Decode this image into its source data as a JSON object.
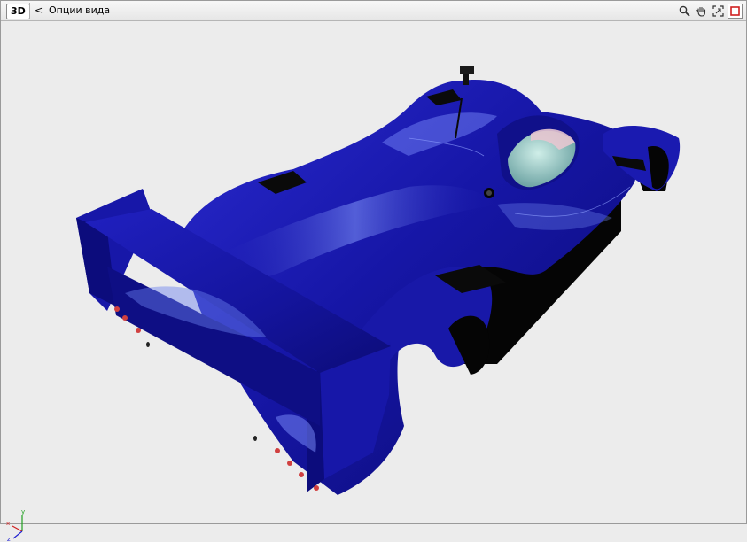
{
  "toolbar": {
    "mode_badge": "3D",
    "options_toggle": "<",
    "options_label": "Опции вида",
    "tools": [
      {
        "icon": "magnifier-icon"
      },
      {
        "icon": "hand-pan-icon"
      },
      {
        "icon": "zoom-extents-icon"
      },
      {
        "icon": "stop-square-icon",
        "active": true
      }
    ]
  },
  "axis": {
    "x": "x",
    "y": "y",
    "z": "z"
  },
  "colors": {
    "body_blue": "#1717a8",
    "body_highlight": "#6f86f0",
    "body_dark": "#080860",
    "axis_x": "#d02020",
    "axis_y": "#20a020",
    "axis_z": "#2020d0",
    "active_tool": "#d02020"
  }
}
